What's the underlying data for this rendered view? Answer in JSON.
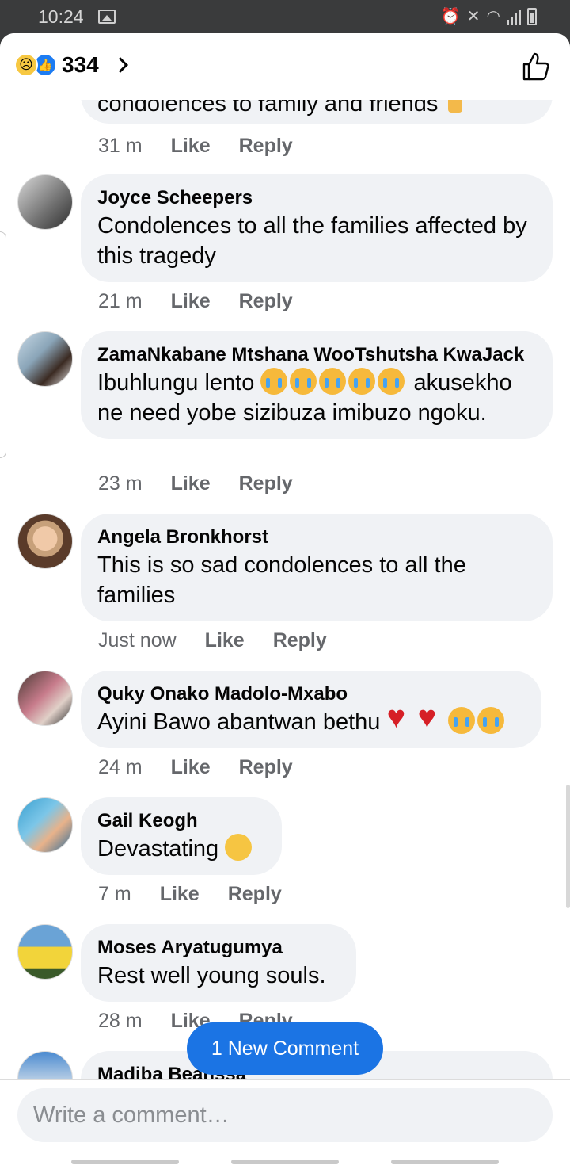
{
  "status": {
    "time": "10:24"
  },
  "header": {
    "reaction_count": "334"
  },
  "comments": [
    {
      "author": "",
      "text": "condolences to family and friends",
      "time": "31 m",
      "like": "Like",
      "reply": "Reply"
    },
    {
      "author": "Joyce Scheepers",
      "text": "Condolences to all the families affected by this tragedy",
      "time": "21 m",
      "like": "Like",
      "reply": "Reply"
    },
    {
      "author": "ZamaNkabane Mtshana WooTshutsha KwaJack",
      "text_before": "Ibuhlungu lento",
      "text_after": "akusekho ne need yobe sizibuza imibuzo ngoku.",
      "time": "23 m",
      "like": "Like",
      "reply": "Reply"
    },
    {
      "author": "Angela Bronkhorst",
      "text": "This is so sad condolences to all the families",
      "time": "Just now",
      "like": "Like",
      "reply": "Reply"
    },
    {
      "author": "Quky Onako Madolo-Mxabo",
      "text": "Ayini Bawo abantwan bethu",
      "time": "24 m",
      "like": "Like",
      "reply": "Reply"
    },
    {
      "author": "Gail Keogh",
      "text": "Devastating",
      "time": "7 m",
      "like": "Like",
      "reply": "Reply"
    },
    {
      "author": "Moses Aryatugumya",
      "text": "Rest well young souls.",
      "time": "28 m",
      "like": "Like",
      "reply": "Reply"
    },
    {
      "author": "Madiba Beanssa"
    }
  ],
  "new_comment_button": "1 New Comment",
  "composer": {
    "placeholder": "Write a comment…"
  }
}
